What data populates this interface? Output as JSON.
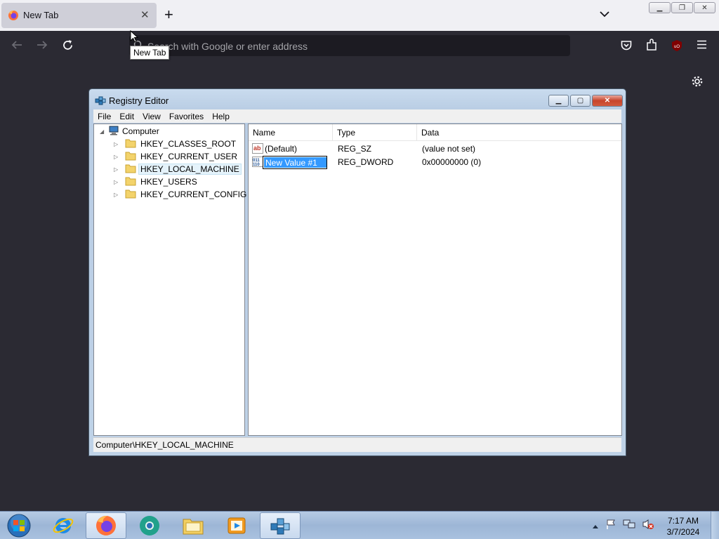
{
  "browser": {
    "tab_title": "New Tab",
    "tooltip": "New Tab",
    "address_placeholder": "Search with Google or enter address"
  },
  "registry_editor": {
    "title": "Registry Editor",
    "menu": [
      "File",
      "Edit",
      "View",
      "Favorites",
      "Help"
    ],
    "tree": {
      "root": "Computer",
      "keys": [
        "HKEY_CLASSES_ROOT",
        "HKEY_CURRENT_USER",
        "HKEY_LOCAL_MACHINE",
        "HKEY_USERS",
        "HKEY_CURRENT_CONFIG"
      ],
      "selected": "HKEY_LOCAL_MACHINE"
    },
    "columns": [
      "Name",
      "Type",
      "Data"
    ],
    "values": [
      {
        "name": "(Default)",
        "type": "REG_SZ",
        "data": "(value not set)",
        "icon": "string-value-icon"
      },
      {
        "name": "New Value #1",
        "type": "REG_DWORD",
        "data": "0x00000000 (0)",
        "icon": "binary-value-icon",
        "editing": true
      }
    ],
    "status": "Computer\\HKEY_LOCAL_MACHINE"
  },
  "taskbar": {
    "apps": [
      "start-orb",
      "internet-explorer-icon",
      "firefox-icon",
      "chrome-like-icon",
      "file-explorer-icon",
      "media-player-icon",
      "registry-editor-icon"
    ],
    "active_app": "registry-editor-icon",
    "time": "7:17 AM",
    "date": "3/7/2024"
  },
  "colors": {
    "browser_bg": "#2b2a33",
    "urlbar_bg": "#1c1b22",
    "selection": "#3399ff",
    "close_red": "#c7442b"
  }
}
